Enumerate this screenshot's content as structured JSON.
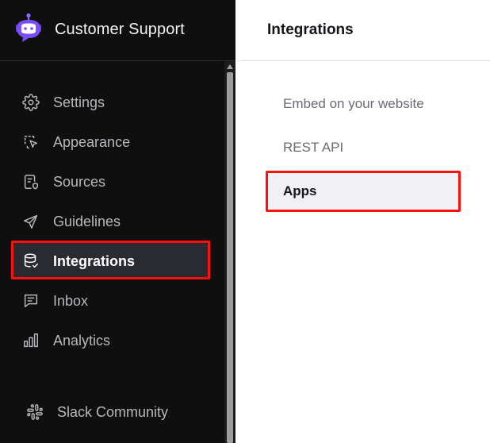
{
  "app": {
    "title": "Customer Support"
  },
  "sidebar": {
    "items": [
      {
        "label": "Settings",
        "icon": "gear-icon",
        "active": false
      },
      {
        "label": "Appearance",
        "icon": "cursor-select-icon",
        "active": false
      },
      {
        "label": "Sources",
        "icon": "document-shield-icon",
        "active": false
      },
      {
        "label": "Guidelines",
        "icon": "send-arrow-icon",
        "active": false
      },
      {
        "label": "Integrations",
        "icon": "database-check-icon",
        "active": true
      },
      {
        "label": "Inbox",
        "icon": "message-square-icon",
        "active": false
      },
      {
        "label": "Analytics",
        "icon": "bar-chart-icon",
        "active": false
      }
    ],
    "footer": {
      "label": "Slack Community",
      "icon": "slack-icon"
    }
  },
  "main": {
    "title": "Integrations",
    "subnav": [
      {
        "label": "Embed on your website",
        "active": false
      },
      {
        "label": "REST API",
        "active": false
      },
      {
        "label": "Apps",
        "active": true
      }
    ]
  },
  "colors": {
    "sidebar_bg": "#0f0f10",
    "active_item_bg": "#2a2b30",
    "highlight": "#ff1010",
    "logo_accent": "#7c4dff"
  }
}
